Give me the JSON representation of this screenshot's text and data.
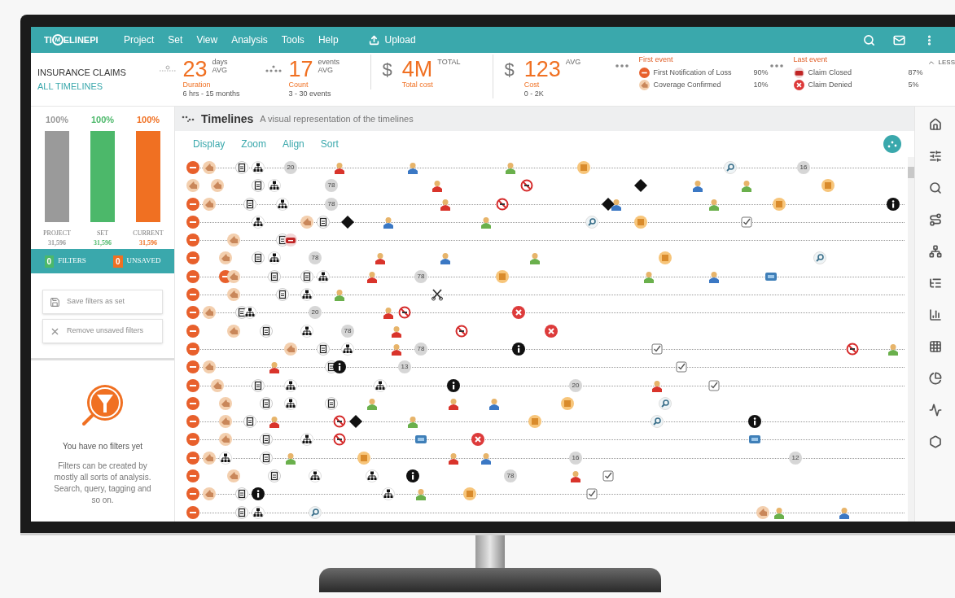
{
  "header": {
    "logo": [
      "TI",
      "M",
      "ELINEPI"
    ],
    "menu": [
      "Project",
      "Set",
      "View",
      "Analysis",
      "Tools",
      "Help"
    ],
    "upload": "Upload"
  },
  "summary": {
    "title": "INSURANCE CLAIMS",
    "subtitle": "ALL TIMELINES",
    "stats": [
      {
        "kind": "duration",
        "value": "23",
        "unit": "days",
        "avg": "AVG",
        "label": "Duration",
        "range": "6 hrs - 15 months"
      },
      {
        "kind": "count",
        "value": "17",
        "unit": "events",
        "avg": "AVG",
        "label": "Count",
        "range": "3 - 30 events"
      },
      {
        "kind": "money",
        "currency": "$",
        "value": "4M",
        "avg": "TOTAL",
        "label": "Total cost"
      },
      {
        "kind": "money",
        "currency": "$",
        "value": "123",
        "avg": "AVG",
        "label": "Cost",
        "range": "0 - 2K"
      }
    ],
    "first_event": {
      "title": "First event",
      "items": [
        {
          "kind": "start",
          "name": "First Notification of Loss",
          "share": "90%"
        },
        {
          "kind": "hand",
          "name": "Coverage Confirmed",
          "share": "10%"
        }
      ]
    },
    "last_event": {
      "title": "Last event",
      "items": [
        {
          "kind": "bag",
          "name": "Claim Closed",
          "share": "87%"
        },
        {
          "kind": "xcircle",
          "name": "Claim Denied",
          "share": "5%"
        }
      ]
    },
    "toggle": "LESS"
  },
  "sidebar": {
    "bars": [
      {
        "percent": "100%",
        "label": "PROJECT",
        "count": "31,596",
        "color": "#9a9a9a"
      },
      {
        "percent": "100%",
        "label": "SET",
        "count": "31,596",
        "color": "#4cb86a"
      },
      {
        "percent": "100%",
        "label": "CURRENT",
        "count": "31,596",
        "color": "#f07022"
      }
    ],
    "counters": [
      {
        "count": "0",
        "label": "FILTERS",
        "color": "#4cb86a"
      },
      {
        "count": "0",
        "label": "UNSAVED",
        "color": "#f07022"
      }
    ],
    "actions": [
      {
        "kind": "save",
        "label": "Save filters as set",
        "disabled": true
      },
      {
        "kind": "remove",
        "label": "Remove unsaved filters",
        "disabled": true
      }
    ],
    "empty_title": "You have no filters yet",
    "empty_text": "Filters can be created by mostly all sorts of analysis. Search, query, tagging and so on."
  },
  "timelines": {
    "title": "Timelines",
    "subtitle": "A visual representation of the timelines",
    "tabs": [
      "Display",
      "Zoom",
      "Align",
      "Sort"
    ],
    "rows": [
      {
        "dotted": true,
        "events": [
          {
            "kind": "start"
          },
          {
            "kind": "hand"
          },
          {
            "kind": "doc"
          },
          {
            "kind": "org"
          },
          {
            "kind": "number",
            "label": "20"
          },
          {
            "kind": "person",
            "color": "#d9342b"
          },
          {
            "kind": "person",
            "color": "#3b78c4"
          },
          {
            "kind": "person",
            "color": "#6ab04c"
          },
          {
            "kind": "folder"
          },
          {
            "kind": "search"
          },
          {
            "kind": "number",
            "label": "16"
          }
        ]
      },
      {
        "dotted": false,
        "events": [
          {
            "kind": "hand"
          },
          {
            "kind": "hand"
          },
          {
            "kind": "doc"
          },
          {
            "kind": "org"
          },
          {
            "kind": "number",
            "label": "78"
          },
          {
            "kind": "person",
            "color": "#d9342b"
          },
          {
            "kind": "nosign"
          },
          {
            "kind": "diamond"
          },
          {
            "kind": "person",
            "color": "#3b78c4"
          },
          {
            "kind": "person",
            "color": "#6ab04c"
          },
          {
            "kind": "folder"
          }
        ]
      },
      {
        "dotted": true,
        "events": [
          {
            "kind": "start"
          },
          {
            "kind": "hand"
          },
          {
            "kind": "doc"
          },
          {
            "kind": "org"
          },
          {
            "kind": "number",
            "label": "78"
          },
          {
            "kind": "person",
            "color": "#d9342b"
          },
          {
            "kind": "nosign"
          },
          {
            "kind": "diamond"
          },
          {
            "kind": "person",
            "color": "#3b78c4"
          },
          {
            "kind": "person",
            "color": "#6ab04c"
          },
          {
            "kind": "folder"
          },
          {
            "kind": "info"
          }
        ]
      },
      {
        "dotted": true,
        "events": [
          {
            "kind": "start"
          },
          {
            "kind": "org"
          },
          {
            "kind": "hand"
          },
          {
            "kind": "doc"
          },
          {
            "kind": "diamond"
          },
          {
            "kind": "person",
            "color": "#3b78c4"
          },
          {
            "kind": "person",
            "color": "#6ab04c"
          },
          {
            "kind": "search"
          },
          {
            "kind": "folder"
          },
          {
            "kind": "check"
          }
        ]
      },
      {
        "dotted": true,
        "events": [
          {
            "kind": "start"
          },
          {
            "kind": "hand"
          },
          {
            "kind": "doc"
          },
          {
            "kind": "bag"
          }
        ]
      },
      {
        "dotted": false,
        "events": [
          {
            "kind": "start"
          },
          {
            "kind": "hand"
          },
          {
            "kind": "doc"
          },
          {
            "kind": "org"
          },
          {
            "kind": "number",
            "label": "78"
          },
          {
            "kind": "person",
            "color": "#d9342b"
          },
          {
            "kind": "person",
            "color": "#3b78c4"
          },
          {
            "kind": "person",
            "color": "#6ab04c"
          },
          {
            "kind": "folder"
          },
          {
            "kind": "search"
          }
        ]
      },
      {
        "dotted": true,
        "events": [
          {
            "kind": "start"
          },
          {
            "kind": "start"
          },
          {
            "kind": "hand"
          },
          {
            "kind": "doc"
          },
          {
            "kind": "doc"
          },
          {
            "kind": "org"
          },
          {
            "kind": "person",
            "color": "#d9342b"
          },
          {
            "kind": "number",
            "label": "78"
          },
          {
            "kind": "folder"
          },
          {
            "kind": "person",
            "color": "#6ab04c"
          },
          {
            "kind": "person",
            "color": "#3b78c4"
          },
          {
            "kind": "bluebox"
          }
        ]
      },
      {
        "dotted": true,
        "events": [
          {
            "kind": "start"
          },
          {
            "kind": "hand"
          },
          {
            "kind": "doc"
          },
          {
            "kind": "org"
          },
          {
            "kind": "person",
            "color": "#6ab04c"
          },
          {
            "kind": "scissors"
          }
        ]
      },
      {
        "dotted": true,
        "events": [
          {
            "kind": "start"
          },
          {
            "kind": "hand"
          },
          {
            "kind": "doc"
          },
          {
            "kind": "org"
          },
          {
            "kind": "number",
            "label": "20"
          },
          {
            "kind": "person",
            "color": "#d9342b"
          },
          {
            "kind": "nosign"
          },
          {
            "kind": "xcircle"
          }
        ]
      },
      {
        "dotted": false,
        "events": [
          {
            "kind": "start"
          },
          {
            "kind": "hand"
          },
          {
            "kind": "doc"
          },
          {
            "kind": "org"
          },
          {
            "kind": "number",
            "label": "78"
          },
          {
            "kind": "person",
            "color": "#d9342b"
          },
          {
            "kind": "nosign"
          },
          {
            "kind": "xcircle"
          }
        ]
      },
      {
        "dotted": true,
        "events": [
          {
            "kind": "start"
          },
          {
            "kind": "hand"
          },
          {
            "kind": "doc"
          },
          {
            "kind": "org"
          },
          {
            "kind": "person",
            "color": "#d9342b"
          },
          {
            "kind": "number",
            "label": "78"
          },
          {
            "kind": "info"
          },
          {
            "kind": "check"
          },
          {
            "kind": "nosign"
          },
          {
            "kind": "person",
            "color": "#6ab04c"
          }
        ]
      },
      {
        "dotted": true,
        "events": [
          {
            "kind": "start"
          },
          {
            "kind": "hand"
          },
          {
            "kind": "person",
            "color": "#d9342b"
          },
          {
            "kind": "doc"
          },
          {
            "kind": "info"
          },
          {
            "kind": "number",
            "label": "13"
          },
          {
            "kind": "check"
          }
        ]
      },
      {
        "dotted": true,
        "events": [
          {
            "kind": "start"
          },
          {
            "kind": "hand"
          },
          {
            "kind": "doc"
          },
          {
            "kind": "org"
          },
          {
            "kind": "org"
          },
          {
            "kind": "info"
          },
          {
            "kind": "number",
            "label": "20"
          },
          {
            "kind": "person",
            "color": "#d9342b"
          },
          {
            "kind": "check"
          }
        ]
      },
      {
        "dotted": false,
        "events": [
          {
            "kind": "start"
          },
          {
            "kind": "hand"
          },
          {
            "kind": "doc"
          },
          {
            "kind": "org"
          },
          {
            "kind": "doc"
          },
          {
            "kind": "person",
            "color": "#6ab04c"
          },
          {
            "kind": "person",
            "color": "#d9342b"
          },
          {
            "kind": "person",
            "color": "#3b78c4"
          },
          {
            "kind": "folder"
          },
          {
            "kind": "search"
          }
        ]
      },
      {
        "dotted": true,
        "events": [
          {
            "kind": "start"
          },
          {
            "kind": "hand"
          },
          {
            "kind": "doc"
          },
          {
            "kind": "person",
            "color": "#d9342b"
          },
          {
            "kind": "nosign"
          },
          {
            "kind": "diamond"
          },
          {
            "kind": "person",
            "color": "#6ab04c"
          },
          {
            "kind": "folder"
          },
          {
            "kind": "search"
          },
          {
            "kind": "info"
          }
        ]
      },
      {
        "dotted": true,
        "events": [
          {
            "kind": "start"
          },
          {
            "kind": "hand"
          },
          {
            "kind": "doc"
          },
          {
            "kind": "org"
          },
          {
            "kind": "nosign"
          },
          {
            "kind": "bluebox"
          },
          {
            "kind": "xcircle"
          },
          {
            "kind": "bluebox"
          }
        ]
      },
      {
        "dotted": true,
        "events": [
          {
            "kind": "start"
          },
          {
            "kind": "hand"
          },
          {
            "kind": "org"
          },
          {
            "kind": "doc"
          },
          {
            "kind": "person",
            "color": "#6ab04c"
          },
          {
            "kind": "folder"
          },
          {
            "kind": "person",
            "color": "#d9342b"
          },
          {
            "kind": "person",
            "color": "#3b78c4"
          },
          {
            "kind": "number",
            "label": "16"
          },
          {
            "kind": "number",
            "label": "12"
          }
        ]
      },
      {
        "dotted": false,
        "events": [
          {
            "kind": "start"
          },
          {
            "kind": "hand"
          },
          {
            "kind": "doc"
          },
          {
            "kind": "org"
          },
          {
            "kind": "org"
          },
          {
            "kind": "info"
          },
          {
            "kind": "number",
            "label": "78"
          },
          {
            "kind": "person",
            "color": "#d9342b"
          },
          {
            "kind": "check"
          }
        ]
      },
      {
        "dotted": true,
        "events": [
          {
            "kind": "start"
          },
          {
            "kind": "hand"
          },
          {
            "kind": "doc"
          },
          {
            "kind": "info"
          },
          {
            "kind": "org"
          },
          {
            "kind": "person",
            "color": "#6ab04c"
          },
          {
            "kind": "folder"
          },
          {
            "kind": "check"
          }
        ]
      },
      {
        "dotted": true,
        "events": [
          {
            "kind": "start"
          },
          {
            "kind": "doc"
          },
          {
            "kind": "org"
          },
          {
            "kind": "search"
          },
          {
            "kind": "hand"
          },
          {
            "kind": "person",
            "color": "#6ab04c"
          },
          {
            "kind": "person",
            "color": "#3b78c4"
          }
        ]
      }
    ]
  }
}
